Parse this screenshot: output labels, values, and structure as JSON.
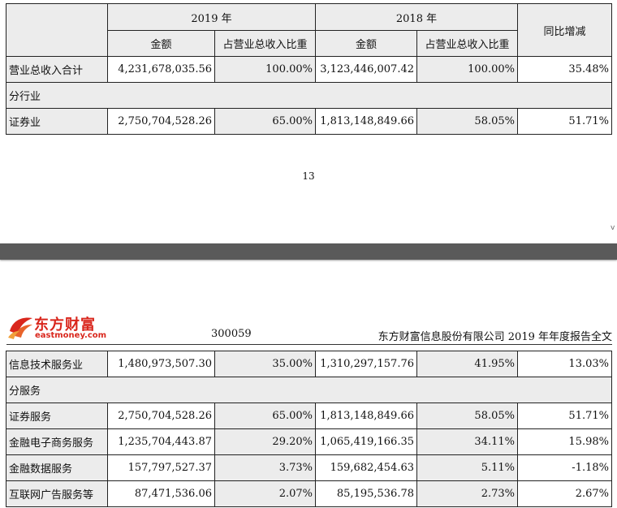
{
  "table_top": {
    "header": {
      "year_2019": "2019 年",
      "year_2018": "2018 年",
      "amount": "金额",
      "share": "占营业总收入比重",
      "yoy": "同比增减"
    },
    "rows": [
      {
        "label": "营业总收入合计",
        "amount_2019": "4,231,678,035.56",
        "share_2019": "100.00%",
        "amount_2018": "3,123,446,007.42",
        "share_2018": "100.00%",
        "yoy": "35.48%"
      },
      {
        "section": "分行业"
      },
      {
        "label": "证券业",
        "amount_2019": "2,750,704,528.26",
        "share_2019": "65.00%",
        "amount_2018": "1,813,148,849.66",
        "share_2018": "58.05%",
        "yoy": "51.71%"
      }
    ]
  },
  "page_number": "13",
  "side_mark": "v",
  "header": {
    "logo_cn": "东方财富",
    "logo_en": "eastmoney.com",
    "stock_code": "300059",
    "report_title": "东方财富信息股份有限公司 2019 年年度报告全文"
  },
  "table_bottom": {
    "rows": [
      {
        "label": "信息技术服务业",
        "amount_2019": "1,480,973,507.30",
        "share_2019": "35.00%",
        "amount_2018": "1,310,297,157.76",
        "share_2018": "41.95%",
        "yoy": "13.03%"
      },
      {
        "section": "分服务"
      },
      {
        "label": "证券服务",
        "amount_2019": "2,750,704,528.26",
        "share_2019": "65.00%",
        "amount_2018": "1,813,148,849.66",
        "share_2018": "58.05%",
        "yoy": "51.71%"
      },
      {
        "label": "金融电子商务服务",
        "amount_2019": "1,235,704,443.87",
        "share_2019": "29.20%",
        "amount_2018": "1,065,419,166.35",
        "share_2018": "34.11%",
        "yoy": "15.98%"
      },
      {
        "label": "金融数据服务",
        "amount_2019": "157,797,527.37",
        "share_2019": "3.73%",
        "amount_2018": "159,682,454.63",
        "share_2018": "5.11%",
        "yoy": "-1.18%"
      },
      {
        "label": "互联网广告服务等",
        "amount_2019": "87,471,536.06",
        "share_2019": "2.07%",
        "amount_2018": "85,195,536.78",
        "share_2018": "2.73%",
        "yoy": "2.67%"
      }
    ]
  },
  "colors": {
    "brand_red": "#d9261c",
    "cell_grey": "#ececec"
  }
}
